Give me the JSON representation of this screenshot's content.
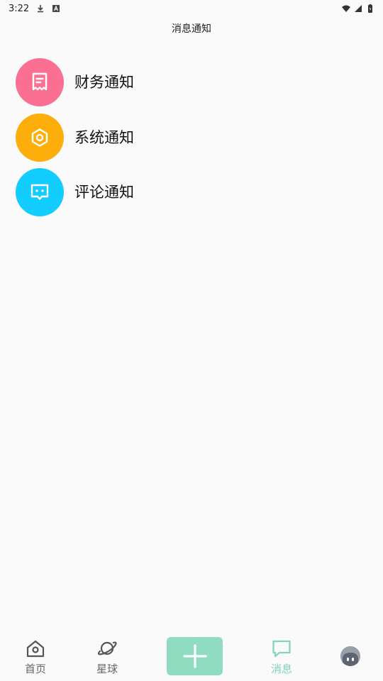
{
  "status_bar": {
    "time": "3:22",
    "icons": [
      "download-icon",
      "a-badge-icon",
      "wifi-icon",
      "signal-icon",
      "battery-icon"
    ]
  },
  "header": {
    "title": "消息通知"
  },
  "notifications": [
    {
      "label": "财务通知",
      "icon": "receipt-icon",
      "color": "#fb6f92"
    },
    {
      "label": "系统通知",
      "icon": "hexagon-settings-icon",
      "color": "#fcae0a"
    },
    {
      "label": "评论通知",
      "icon": "chat-bubble-icon",
      "color": "#12cdfd"
    }
  ],
  "bottom_nav": {
    "items": [
      {
        "label": "首页",
        "icon": "home-icon",
        "active": false
      },
      {
        "label": "星球",
        "icon": "planet-icon",
        "active": false
      },
      {
        "label": "消息",
        "icon": "message-icon",
        "active": true
      }
    ],
    "add_button_icon": "plus-icon",
    "profile_icon": "avatar-icon",
    "active_color": "#7dd6b8",
    "add_button_color": "#8fdcc0"
  }
}
